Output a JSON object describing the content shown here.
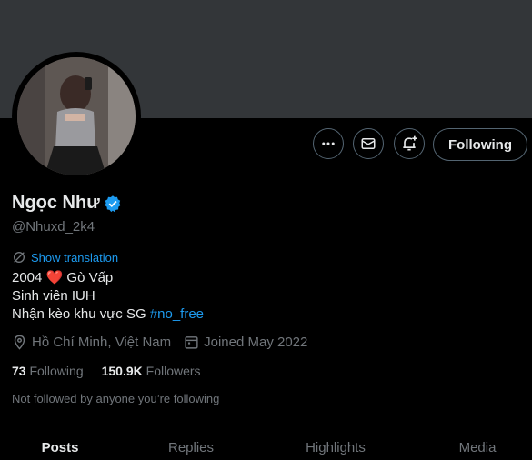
{
  "profile": {
    "name": "Ngọc Như",
    "handle": "@Nhuxd_2k4",
    "show_translation": "Show translation",
    "bio": {
      "line1_a": "2004",
      "line1_b": "Gò Vấp",
      "line2": "Sinh viên IUH",
      "line3": "Nhận kèo khu vực SG",
      "hashtag": "#no_free"
    },
    "location": "Hồ Chí Minh, Việt Nam",
    "joined": "Joined May 2022",
    "following_count": "73",
    "following_label": "Following",
    "followers_count": "150.9K",
    "followers_label": "Followers",
    "not_followed_note": "Not followed by anyone you’re following"
  },
  "actions": {
    "more_icon": "more-icon",
    "message_icon": "mail-icon",
    "notify_icon": "bell-plus-icon",
    "follow_button": "Following"
  },
  "tabs": [
    {
      "label": "Posts",
      "active": true
    },
    {
      "label": "Replies",
      "active": false
    },
    {
      "label": "Highlights",
      "active": false
    },
    {
      "label": "Media",
      "active": false
    }
  ],
  "colors": {
    "accent": "#1d9bf0",
    "banner": "#333639",
    "heart": "#f91880"
  }
}
